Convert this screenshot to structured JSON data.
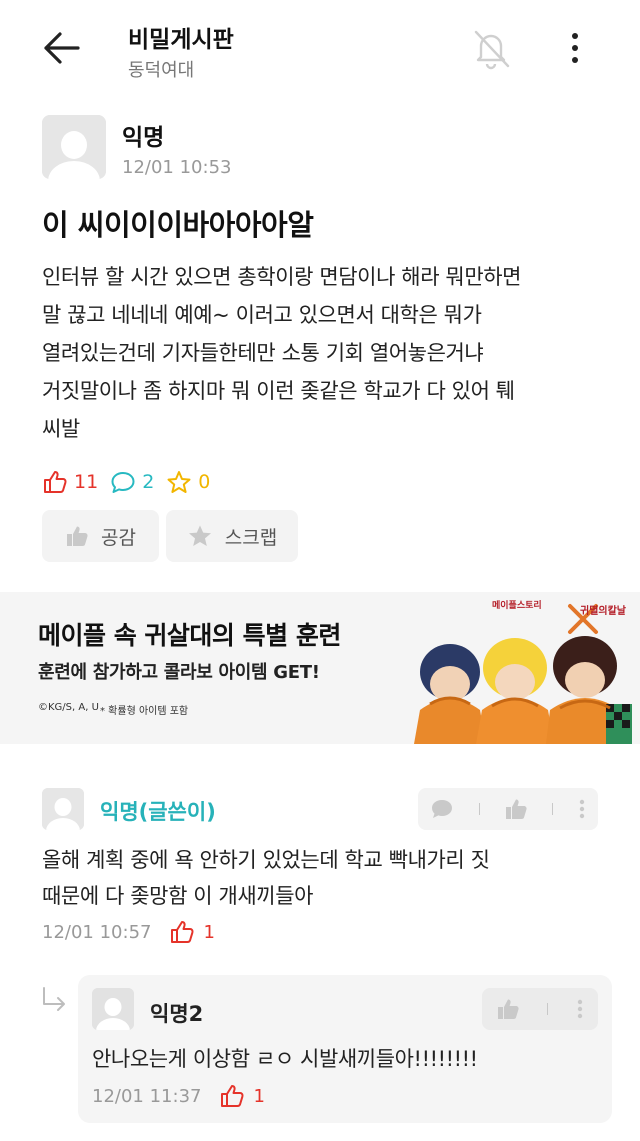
{
  "header": {
    "title": "비밀게시판",
    "subtitle": "동덕여대",
    "back_icon": "back-arrow-icon",
    "bell_icon": "bell-off-icon",
    "more_icon": "more-vertical-icon"
  },
  "post": {
    "author": "익명",
    "time": "12/01 10:53",
    "title": "이 씨이이이바아아아알",
    "body_lines": [
      "인터뷰 할 시간 있으면 총학이랑 면담이나 해라 뭐만하면",
      "말 끊고 네네네 예예~ 이러고 있으면서 대학은 뭐가",
      "열려있는건데 기자들한테만 소통 기회 열어놓은거냐",
      "거짓말이나 좀 하지마 뭐 이런 좆같은 학교가 다 있어 퉤",
      "씨발"
    ],
    "stats": {
      "likes": "11",
      "comments": "2",
      "scraps": "0"
    },
    "actions": {
      "like_label": "공감",
      "scrap_label": "스크랩"
    }
  },
  "ad": {
    "title": "메이플 속 귀살대의 특별 훈련",
    "subtitle": "훈련에 참가하고 콜라보 아이템 GET!",
    "copyright": "©KG/S, A, U",
    "note": "* 확률형 아이템 포함",
    "logo_text": "메이플스토리",
    "logo_text2": "귀멸의칼날"
  },
  "comments": [
    {
      "author": "익명(글쓴이)",
      "body_lines": [
        "올해 계획 중에 욕 안하기 있었는데 학교 빡내가리 짓",
        "때문에 다 좆망함 이 개새끼들아"
      ],
      "time": "12/01 10:57",
      "likes": "1"
    }
  ],
  "reply": {
    "author": "익명2",
    "body": "안나오는게 이상함 ㄹㅇ 시발새끼들아!!!!!!!!",
    "time": "12/01 11:37",
    "likes": "1"
  },
  "colors": {
    "like": "#e5332a",
    "comment": "#27b9c1",
    "scrap": "#f2b600",
    "op_name": "#27b2b9"
  }
}
